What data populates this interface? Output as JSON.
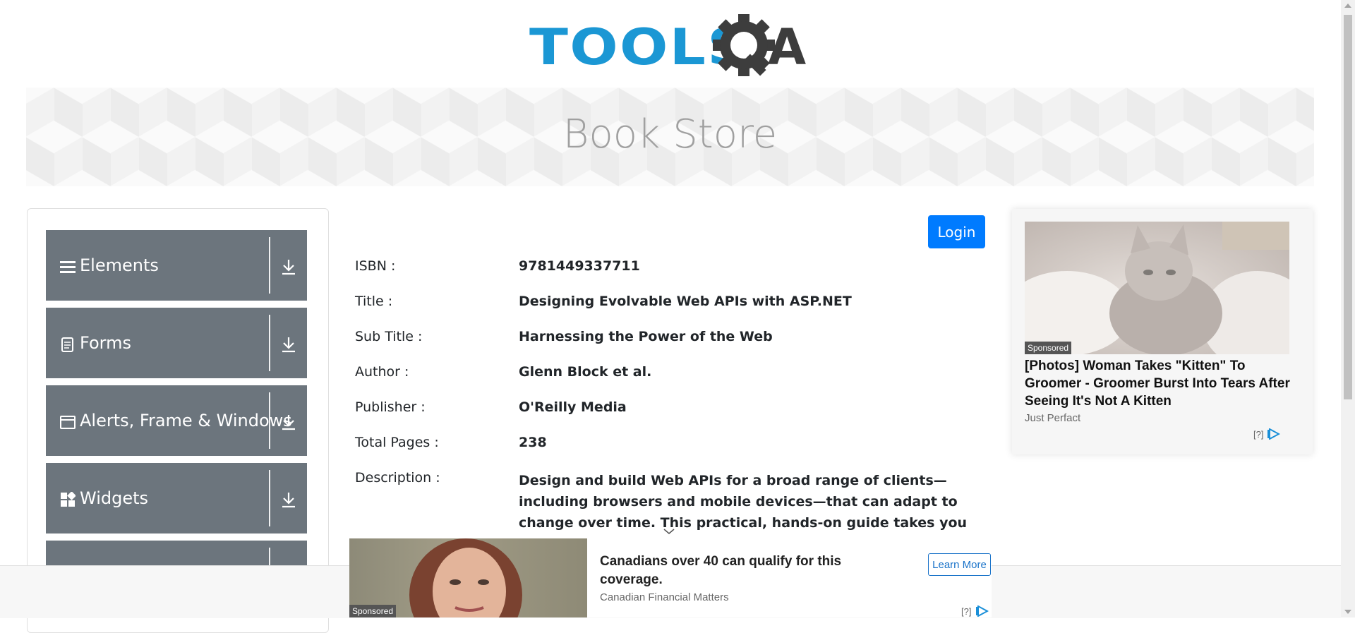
{
  "header": {
    "logo_text": "TOOLS",
    "logo_a": "A"
  },
  "banner": {
    "title": "Book Store"
  },
  "sidebar": {
    "groups": [
      {
        "label": "Elements",
        "icon": "hamburger-icon"
      },
      {
        "label": "Forms",
        "icon": "document-icon"
      },
      {
        "label": "Alerts, Frame & Windows",
        "icon": "window-icon"
      },
      {
        "label": "Widgets",
        "icon": "widgets-icon"
      }
    ]
  },
  "book": {
    "login_label": "Login",
    "isbn_label": "ISBN :",
    "isbn": "9781449337711",
    "title_label": "Title :",
    "title": "Designing Evolvable Web APIs with ASP.NET",
    "subtitle_label": "Sub Title :",
    "subtitle": "Harnessing the Power of the Web",
    "author_label": "Author :",
    "author": "Glenn Block et al.",
    "publisher_label": "Publisher :",
    "publisher": "O'Reilly Media",
    "pages_label": "Total Pages :",
    "pages": "238",
    "description_label": "Description :",
    "description": "Design and build Web APIs for a broad range of clients—including browsers and mobile devices—that can adapt to change over time. This practical, hands-on guide takes you through the theory and tools you"
  },
  "right_ad": {
    "sponsored": "Sponsored",
    "headline": "[Photos] Woman Takes \"Kitten\" To Groomer - Groomer Burst Into Tears After Seeing It's Not A Kitten",
    "source": "Just Perfact",
    "question": "[?]"
  },
  "bottom_ad": {
    "sponsored": "Sponsored",
    "headline": "Canadians over 40 can qualify for this coverage.",
    "source": "Canadian Financial Matters",
    "cta": "Learn More",
    "question": "[?]"
  },
  "colors": {
    "brand_blue": "#1b97d4",
    "sidebar_gray": "#6c757d",
    "login_blue": "#007bff"
  }
}
